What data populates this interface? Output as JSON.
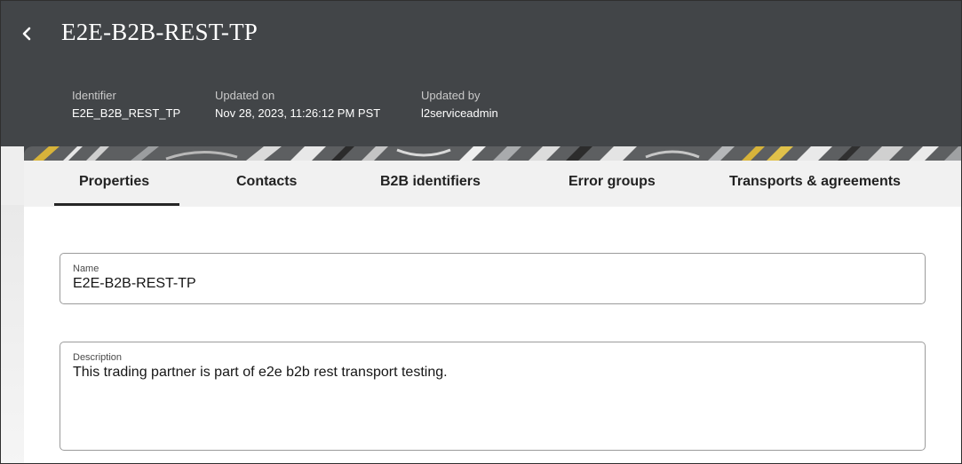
{
  "header": {
    "title": "E2E-B2B-REST-TP",
    "back_icon": "chevron-left-icon",
    "meta": [
      {
        "label": "Identifier",
        "value": "E2E_B2B_REST_TP"
      },
      {
        "label": "Updated on",
        "value": "Nov 28, 2023, 11:26:12 PM PST"
      },
      {
        "label": "Updated by",
        "value": "l2serviceadmin"
      }
    ]
  },
  "tabs": [
    {
      "label": "Properties",
      "selected": true
    },
    {
      "label": "Contacts",
      "selected": false
    },
    {
      "label": "B2B identifiers",
      "selected": false
    },
    {
      "label": "Error groups",
      "selected": false
    },
    {
      "label": "Transports & agreements",
      "selected": false
    }
  ],
  "form": {
    "name": {
      "label": "Name",
      "value": "E2E-B2B-REST-TP"
    },
    "description": {
      "label": "Description",
      "value": "This trading partner is part of e2e b2b rest transport testing."
    }
  },
  "colors": {
    "header_bg": "#424548",
    "tabbar_bg": "#f1f1f1",
    "pattern_accent": "#d7b33a"
  }
}
